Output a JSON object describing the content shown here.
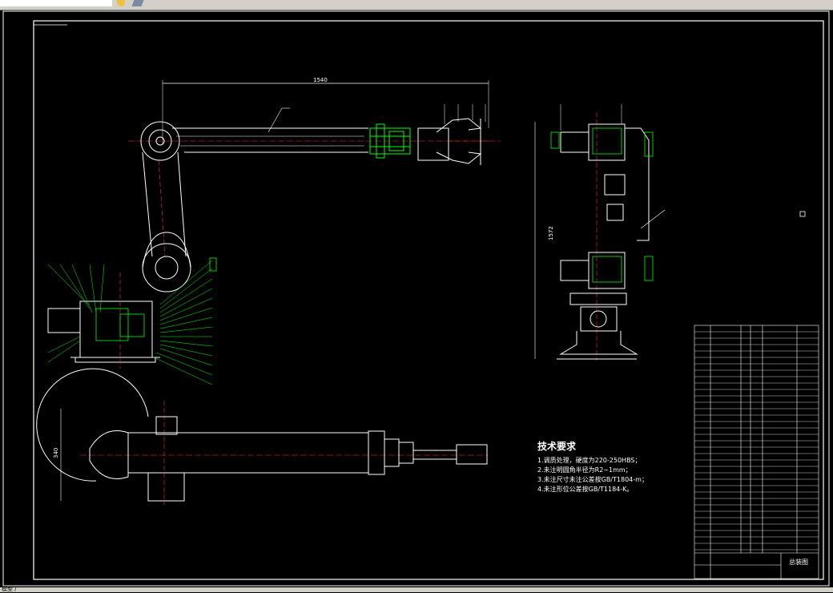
{
  "tech_req": {
    "title": "技术要求",
    "lines": [
      "1.调质处理，硬度为220-250HBS；",
      "2.未注明圆角半径为R2~1mm；",
      "3.未注尺寸未注公差按GB/T1804-m；",
      "4.未注形位公差按GB/T1184-K。"
    ]
  },
  "dims": {
    "top_length": "1540",
    "side_height": "1572",
    "bottom_width": "340"
  },
  "title_block": {
    "name": "总装图"
  },
  "status": {
    "text": "模型 /"
  },
  "colors": {
    "line": "#ffffff",
    "dim": "#ff3030",
    "green": "#00ff00",
    "frame": "#ffffff"
  }
}
